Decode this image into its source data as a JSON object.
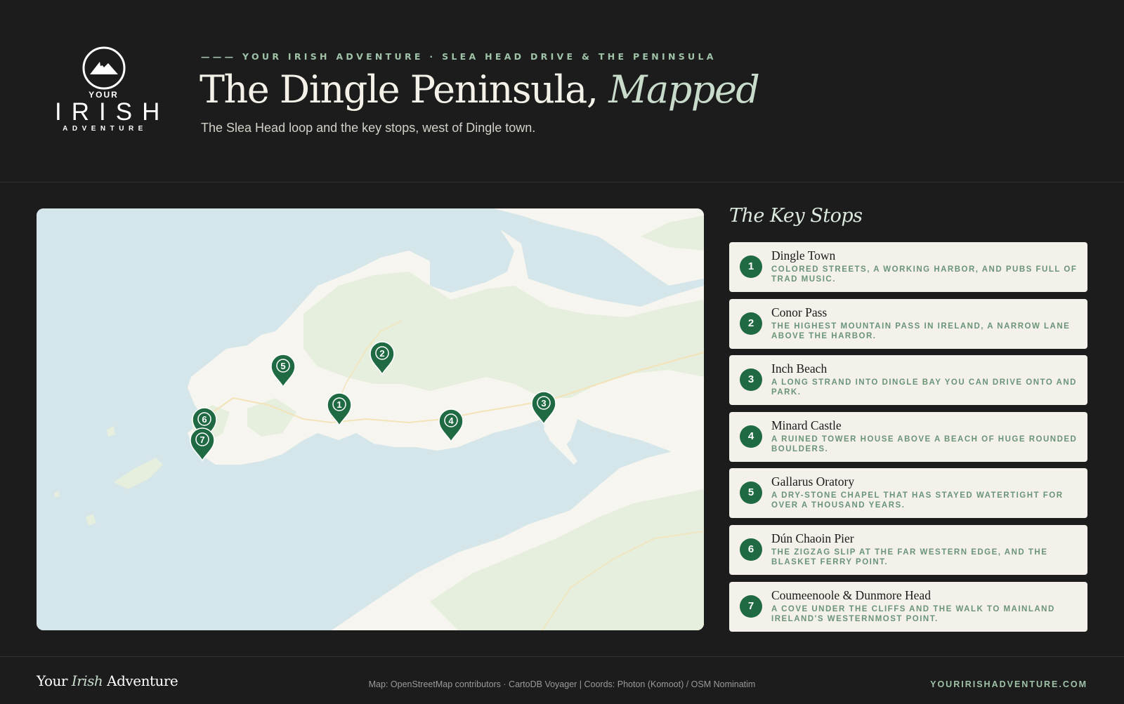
{
  "brand": {
    "logo_your": "YOUR",
    "logo_irish": "IRISH",
    "logo_adventure": "ADVENTURE",
    "logo_icon": "mountain-icon"
  },
  "header": {
    "eyebrow": "——— YOUR IRISH ADVENTURE · SLEA HEAD DRIVE & THE PENINSULA",
    "title_main": "The Dingle Peninsula, ",
    "title_accent": "Mapped",
    "subtitle": "The Slea Head loop and the key stops, west of Dingle town."
  },
  "map": {
    "land_color": "#f7f5ef",
    "green_color": "#e6eedd",
    "water_color": "#d5e6ea",
    "marker_color": "#1f6a43",
    "markers": [
      {
        "num": "1",
        "name": "Dingle Town"
      },
      {
        "num": "2",
        "name": "Conor Pass"
      },
      {
        "num": "3",
        "name": "Inch Beach"
      },
      {
        "num": "4",
        "name": "Minard Castle"
      },
      {
        "num": "5",
        "name": "Gallarus Oratory"
      },
      {
        "num": "6",
        "name": "Dún Chaoin Pier"
      },
      {
        "num": "7",
        "name": "Coumeenoole & Dunmore Head"
      }
    ]
  },
  "stops_title": "The Key Stops",
  "stops": [
    {
      "num": "1",
      "name": "Dingle Town",
      "desc": "Colored streets, a working harbor, and pubs full of trad music."
    },
    {
      "num": "2",
      "name": "Conor Pass",
      "desc": "The highest mountain pass in Ireland, a narrow lane above the harbor."
    },
    {
      "num": "3",
      "name": "Inch Beach",
      "desc": "A long strand into Dingle Bay you can drive onto and park."
    },
    {
      "num": "4",
      "name": "Minard Castle",
      "desc": "A ruined tower house above a beach of huge rounded boulders."
    },
    {
      "num": "5",
      "name": "Gallarus Oratory",
      "desc": "A dry-stone chapel that has stayed watertight for over a thousand years."
    },
    {
      "num": "6",
      "name": "Dún Chaoin Pier",
      "desc": "The zigzag slip at the far western edge, and the Blasket ferry point."
    },
    {
      "num": "7",
      "name": "Coumeenoole & Dunmore Head",
      "desc": "A cove under the cliffs and the walk to mainland Ireland's westernmost point."
    }
  ],
  "footer": {
    "brand_pre": "Your ",
    "brand_accent": "Irish",
    "brand_post": " Adventure",
    "credit": "Map: OpenStreetMap contributors · CartoDB Voyager | Coords: Photon (Komoot) / OSM Nominatim",
    "url": "YOURIRISHADVENTURE.COM"
  }
}
